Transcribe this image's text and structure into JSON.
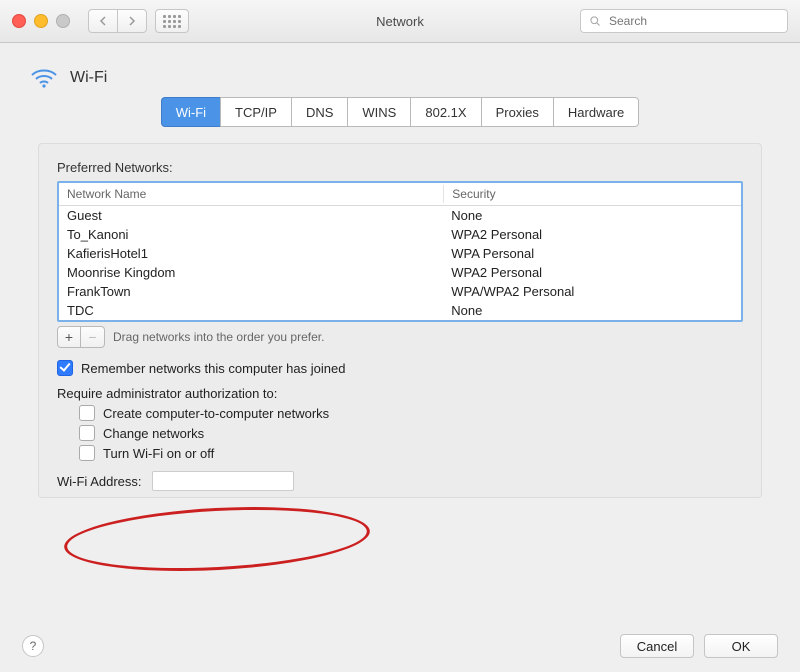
{
  "window": {
    "title": "Network"
  },
  "toolbar": {
    "search_placeholder": "Search"
  },
  "header": {
    "title": "Wi-Fi"
  },
  "tabs": [
    "Wi-Fi",
    "TCP/IP",
    "DNS",
    "WINS",
    "802.1X",
    "Proxies",
    "Hardware"
  ],
  "active_tab": 0,
  "preferred": {
    "label": "Preferred Networks:",
    "columns": [
      "Network Name",
      "Security"
    ],
    "rows": [
      {
        "name": "Guest",
        "security": "None"
      },
      {
        "name": "To_Kanoni",
        "security": "WPA2 Personal"
      },
      {
        "name": "KafierisHotel1",
        "security": "WPA Personal"
      },
      {
        "name": "Moonrise Kingdom",
        "security": "WPA2 Personal"
      },
      {
        "name": "FrankTown",
        "security": "WPA/WPA2 Personal"
      },
      {
        "name": "TDC",
        "security": "None"
      }
    ],
    "drag_hint": "Drag networks into the order you prefer."
  },
  "options": {
    "remember": {
      "label": "Remember networks this computer has joined",
      "checked": true
    },
    "require_label": "Require administrator authorization to:",
    "require": [
      {
        "label": "Create computer-to-computer networks",
        "checked": false
      },
      {
        "label": "Change networks",
        "checked": false
      },
      {
        "label": "Turn Wi-Fi on or off",
        "checked": false
      }
    ]
  },
  "wifi_address": {
    "label": "Wi-Fi Address:",
    "value": ""
  },
  "footer": {
    "cancel": "Cancel",
    "ok": "OK"
  }
}
